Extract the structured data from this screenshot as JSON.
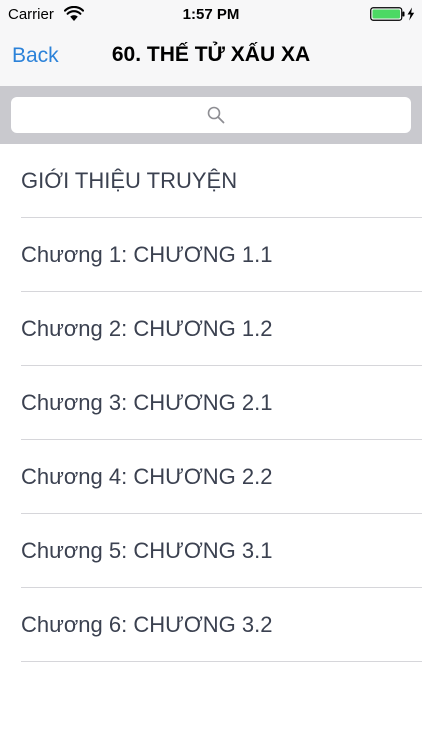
{
  "status_bar": {
    "carrier": "Carrier",
    "time": "1:57 PM",
    "wifi_icon": "wifi-icon",
    "battery_icon": "battery-charging-icon",
    "battery_color": "#4cd964"
  },
  "nav": {
    "back_label": "Back",
    "title": "60. THẾ TỬ XẤU XA",
    "accent_color": "#2b82d9"
  },
  "search": {
    "placeholder": "",
    "value": "",
    "icon": "search-icon"
  },
  "list": {
    "items": [
      {
        "label": "GIỚI THIỆU TRUYỆN"
      },
      {
        "label": "Chương 1: CHƯƠNG 1.1"
      },
      {
        "label": "Chương 2: CHƯƠNG 1.2"
      },
      {
        "label": "Chương 3: CHƯƠNG 2.1"
      },
      {
        "label": "Chương 4: CHƯƠNG 2.2"
      },
      {
        "label": "Chương 5: CHƯƠNG 3.1"
      },
      {
        "label": "Chương 6: CHƯƠNG 3.2"
      }
    ]
  }
}
